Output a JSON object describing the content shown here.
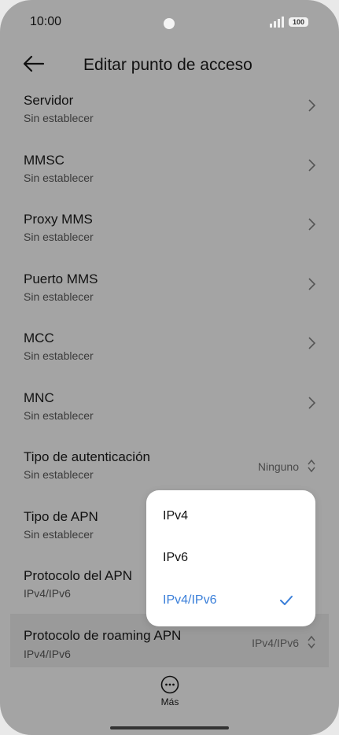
{
  "status_bar": {
    "time": "10:00",
    "battery": "100",
    "icons": [
      "signal-icon",
      "battery-icon"
    ]
  },
  "header": {
    "title": "Editar punto de acceso",
    "back_icon": "arrow-left-icon"
  },
  "list": {
    "items": [
      {
        "title": "Servidor",
        "subtitle": "Sin establecer"
      },
      {
        "title": "MMSC",
        "subtitle": "Sin establecer"
      },
      {
        "title": "Proxy MMS",
        "subtitle": "Sin establecer"
      },
      {
        "title": "Puerto MMS",
        "subtitle": "Sin establecer"
      },
      {
        "title": "MCC",
        "subtitle": "Sin establecer"
      },
      {
        "title": "MNC",
        "subtitle": "Sin establecer"
      },
      {
        "title": "Tipo de autenticación",
        "subtitle": "Sin establecer",
        "value": "Ninguno"
      },
      {
        "title": "Tipo de APN",
        "subtitle": "Sin establecer"
      },
      {
        "title": "Protocolo del APN",
        "subtitle": "IPv4/IPv6"
      },
      {
        "title": "Protocolo de roaming APN",
        "subtitle": "IPv4/IPv6",
        "value": "IPv4/IPv6"
      }
    ]
  },
  "popup": {
    "options": [
      {
        "label": "IPv4"
      },
      {
        "label": "IPv6"
      },
      {
        "label": "IPv4/IPv6"
      }
    ],
    "selected": "IPv4/IPv6",
    "accent_color": "#3a7fd9"
  },
  "bottom": {
    "more_label": "Más",
    "more_icon": "more-horizontal-icon"
  }
}
